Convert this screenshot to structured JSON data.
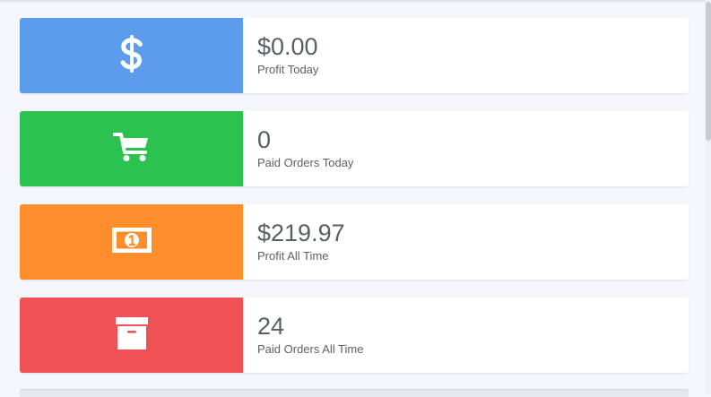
{
  "stats": [
    {
      "value": "$0.00",
      "label": "Profit Today",
      "icon": "dollar-icon",
      "color": "#5b9cec"
    },
    {
      "value": "0",
      "label": "Paid Orders Today",
      "icon": "shopping-cart-icon",
      "color": "#2bc24f"
    },
    {
      "value": "$219.97",
      "label": "Profit All Time",
      "icon": "money-bill-icon",
      "color": "#fe8e2b"
    },
    {
      "value": "24",
      "label": "Paid Orders All Time",
      "icon": "archive-box-icon",
      "color": "#f05154"
    }
  ]
}
